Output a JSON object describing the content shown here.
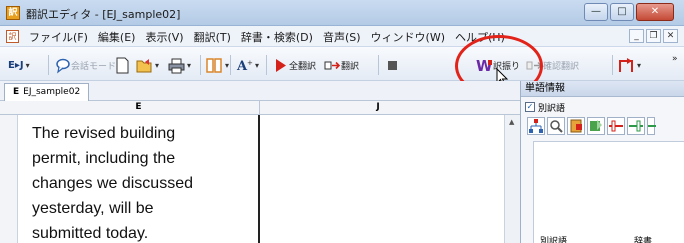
{
  "window": {
    "title": "翻訳エディタ - [EJ_sample02]",
    "minimize": "—",
    "maximize": "□",
    "close": "✕"
  },
  "menubar": {
    "items": [
      "ファイル(F)",
      "編集(E)",
      "表示(V)",
      "翻訳(T)",
      "辞書・検索(D)",
      "音声(S)",
      "ウィンドウ(W)",
      "ヘルプ(H)"
    ],
    "mdi_min": "_",
    "mdi_restore": "❐",
    "mdi_close": "✕"
  },
  "toolbar": {
    "direction_label": "E▸J",
    "conversation_mode": "会話モード",
    "translate_all": "全翻訳",
    "translate": "翻訳",
    "yakuburi": "訳振り",
    "confirm_translate": "確認翻訳",
    "overflow": "»"
  },
  "document": {
    "tab_prefix": "E",
    "tab_name": "EJ_sample02",
    "col_source": "E",
    "col_target": "J",
    "source_lines": [
      "The revised building",
      "permit, including the",
      "changes we discussed",
      "yesterday, will be",
      "submitted today."
    ]
  },
  "panel": {
    "title": "単語情報",
    "checkbox_label": "別訳語",
    "col_alt": "別訳語",
    "col_dict": "辞書"
  },
  "colors": {
    "highlight_ring": "#e2231a",
    "accent_blue": "#1a5fb4"
  }
}
